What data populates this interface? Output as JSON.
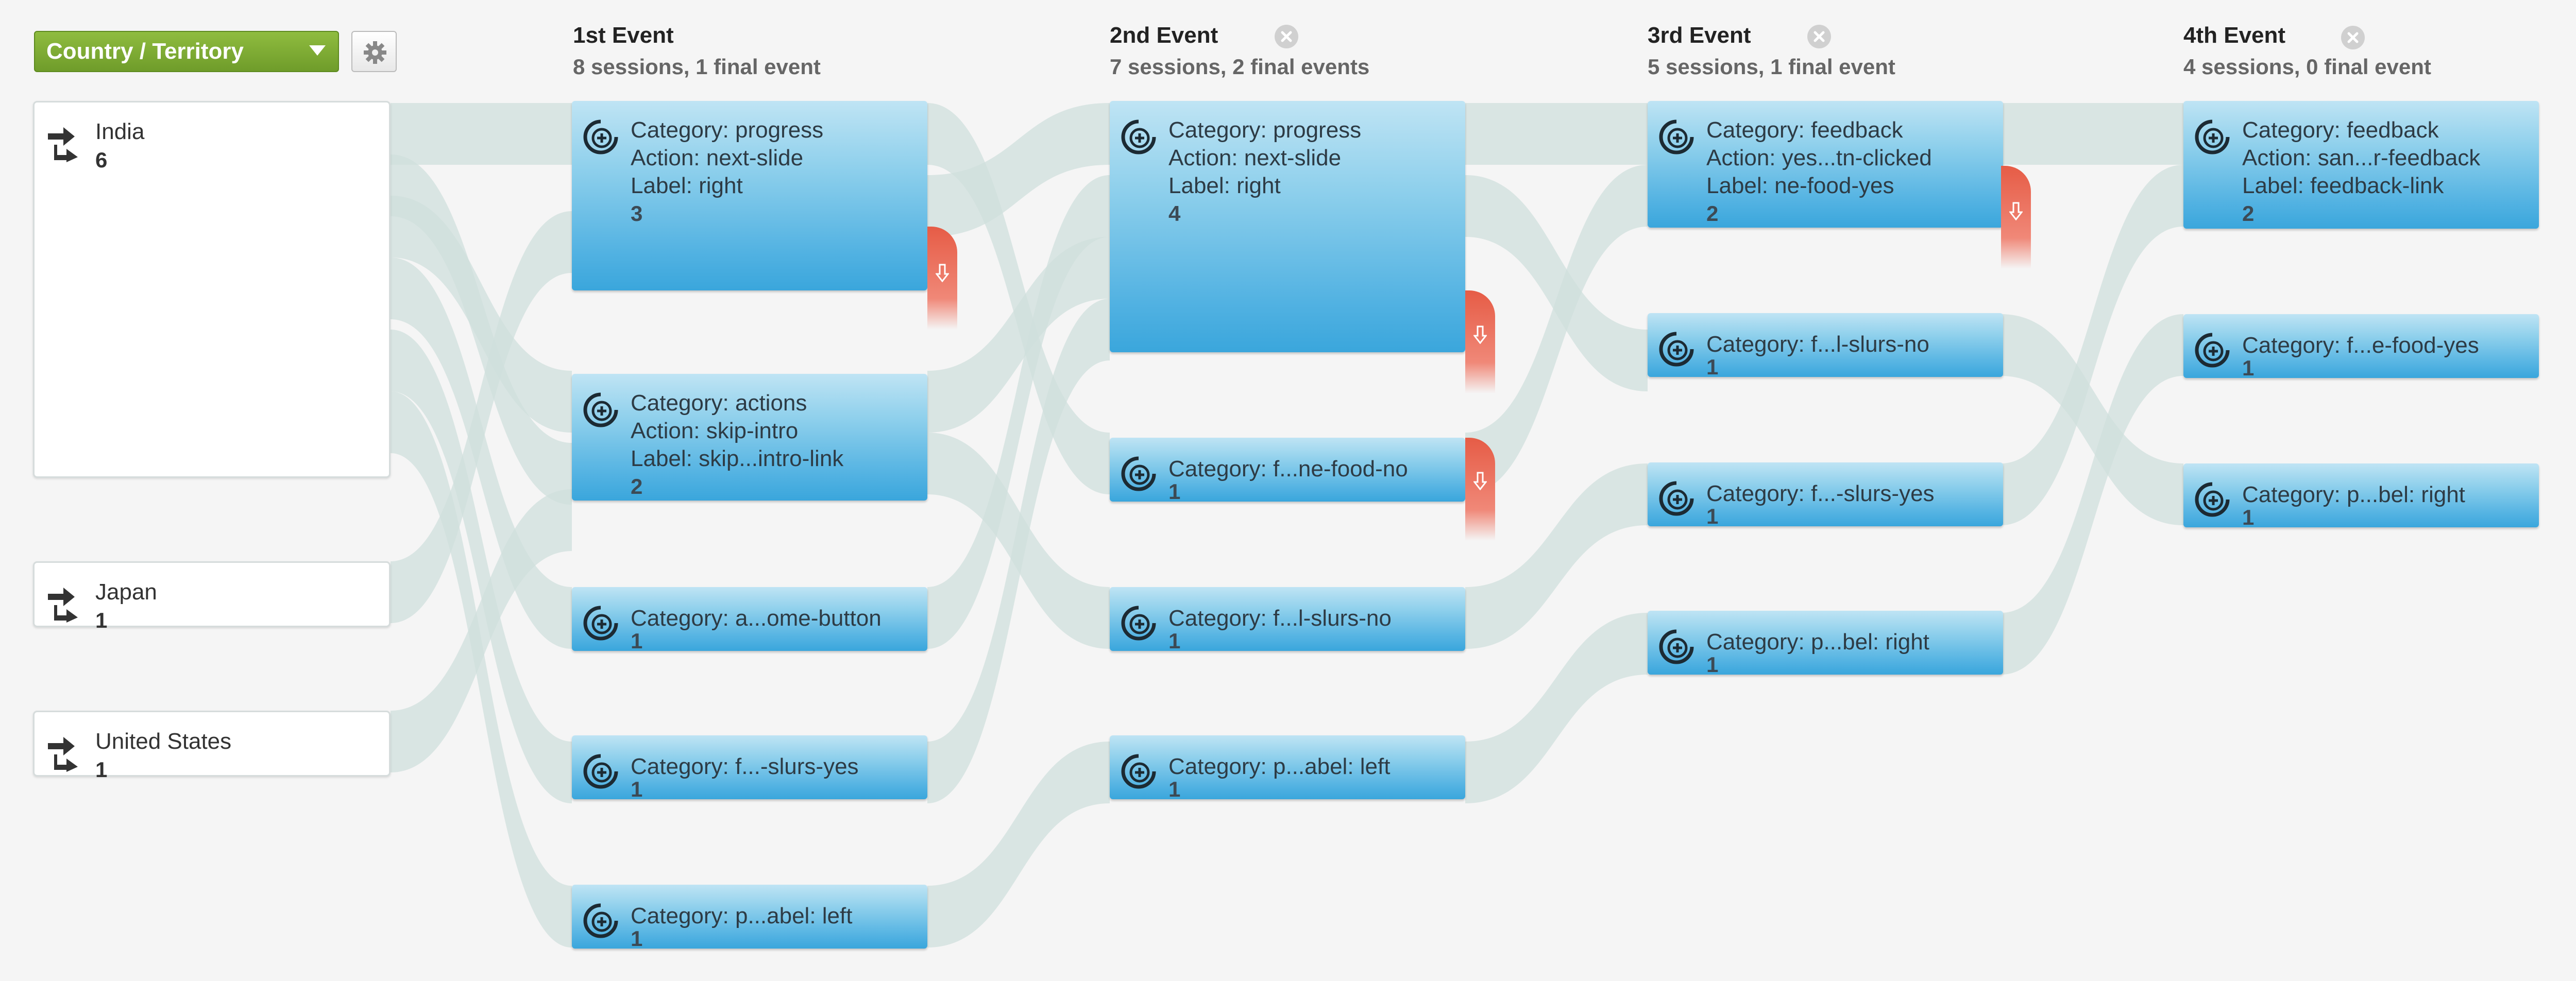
{
  "dimension_selector": {
    "label": "Country / Territory"
  },
  "columns": [
    {
      "title": "1st Event",
      "subtitle": "8 sessions, 1 final event"
    },
    {
      "title": "2nd Event",
      "subtitle": "7 sessions, 2 final events"
    },
    {
      "title": "3rd Event",
      "subtitle": "5 sessions, 1 final event"
    },
    {
      "title": "4th Event",
      "subtitle": "4 sessions, 0 final event"
    }
  ],
  "sources": [
    {
      "name": "India",
      "count": "6"
    },
    {
      "name": "Japan",
      "count": "1"
    },
    {
      "name": "United States",
      "count": "1"
    }
  ],
  "nodes": [
    [
      {
        "lines": [
          "Category: progress",
          "Action: next-slide",
          "Label: right"
        ],
        "count": "3"
      },
      {
        "lines": [
          "Category: actions",
          "Action: skip-intro",
          "Label: skip...intro-link"
        ],
        "count": "2"
      },
      {
        "lines": [
          "Category: a...ome-button"
        ],
        "count": "1"
      },
      {
        "lines": [
          "Category: f...-slurs-yes"
        ],
        "count": "1"
      },
      {
        "lines": [
          "Category: p...abel: left"
        ],
        "count": "1"
      }
    ],
    [
      {
        "lines": [
          "Category: progress",
          "Action: next-slide",
          "Label: right"
        ],
        "count": "4"
      },
      {
        "lines": [
          "Category: f...ne-food-no"
        ],
        "count": "1"
      },
      {
        "lines": [
          "Category: f...l-slurs-no"
        ],
        "count": "1"
      },
      {
        "lines": [
          "Category: p...abel: left"
        ],
        "count": "1"
      }
    ],
    [
      {
        "lines": [
          "Category: feedback",
          "Action: yes...tn-clicked",
          "Label: ne-food-yes"
        ],
        "count": "2"
      },
      {
        "lines": [
          "Category: f...l-slurs-no"
        ],
        "count": "1"
      },
      {
        "lines": [
          "Category: f...-slurs-yes"
        ],
        "count": "1"
      },
      {
        "lines": [
          "Category: p...bel: right"
        ],
        "count": "1"
      }
    ],
    [
      {
        "lines": [
          "Category: feedback",
          "Action: san...r-feedback",
          "Label: feedback-link"
        ],
        "count": "2"
      },
      {
        "lines": [
          "Category: f...e-food-yes"
        ],
        "count": "1"
      },
      {
        "lines": [
          "Category: p...bel: right"
        ],
        "count": "1"
      }
    ]
  ],
  "drop_offs": [
    {
      "from": "1st Event / Category: progress",
      "sessions": 1
    },
    {
      "from": "2nd Event / Category: progress",
      "sessions": 1
    },
    {
      "from": "2nd Event / Category: f...ne-food-no",
      "sessions": 1
    },
    {
      "from": "3rd Event / Category: feedback",
      "sessions": 1
    }
  ],
  "colors": {
    "node_gradient": [
      "#bfe4f4",
      "#3aa6dc"
    ],
    "flow": "#cfdfdc",
    "drop_off": "#e65c46",
    "dimension_selector": "#7aa631",
    "background": "#f5f5f5"
  },
  "icons": [
    "arrow-forward-icon",
    "event-plus-icon",
    "drop-arrow-icon",
    "gear-icon",
    "remove-column-icon",
    "dropdown-caret-icon"
  ]
}
